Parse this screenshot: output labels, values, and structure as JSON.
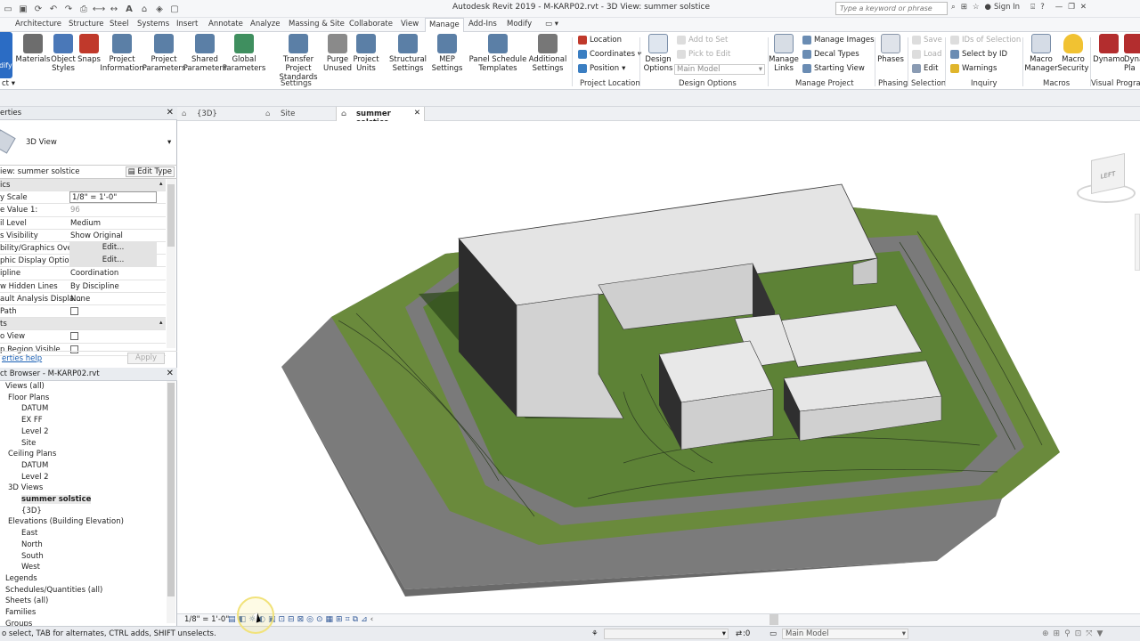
{
  "titlebar": {
    "title": "Autodesk Revit 2019 -  M-KARP02.rvt - 3D View: summer solstice",
    "search_placeholder": "Type a keyword or phrase",
    "sign_in": "Sign In"
  },
  "tabs": [
    "Architecture",
    "Structure",
    "Steel",
    "Systems",
    "Insert",
    "Annotate",
    "Analyze",
    "Massing & Site",
    "Collaborate",
    "View",
    "Manage",
    "Add-Ins",
    "Modify"
  ],
  "active_tab": "Manage",
  "ribbon": {
    "modify": "dify",
    "settings_buttons": [
      {
        "label": "Materials",
        "icon": "materials-icon",
        "color": "#6d6d6d"
      },
      {
        "label": "Object Styles",
        "icon": "object-styles-icon",
        "color": "#4a78b8"
      },
      {
        "label": "Snaps",
        "icon": "snaps-magnet-icon",
        "color": "#c0392b"
      },
      {
        "label": "Project Information",
        "icon": "project-information-icon",
        "color": "#5b7fa6"
      },
      {
        "label": "Project Parameters",
        "icon": "project-parameters-icon",
        "color": "#5b7fa6"
      },
      {
        "label": "Shared Parameters",
        "icon": "shared-parameters-icon",
        "color": "#5b7fa6"
      },
      {
        "label": "Global Parameters",
        "icon": "global-parameters-icon",
        "color": "#3f8f5f"
      },
      {
        "label": "Transfer Project Standards",
        "icon": "transfer-standards-icon",
        "color": "#5b7fa6"
      },
      {
        "label": "Purge Unused",
        "icon": "purge-icon",
        "color": "#8a8a8a"
      },
      {
        "label": "Project Units",
        "icon": "project-units-icon",
        "color": "#5b7fa6"
      },
      {
        "label": "Structural Settings",
        "icon": "structural-settings-icon",
        "color": "#5b7fa6"
      },
      {
        "label": "MEP Settings",
        "icon": "mep-settings-icon",
        "color": "#5b7fa6"
      },
      {
        "label": "Panel Schedule Templates",
        "icon": "panel-schedule-icon",
        "color": "#5b7fa6"
      },
      {
        "label": "Additional Settings",
        "icon": "wrench-icon",
        "color": "#777777"
      }
    ],
    "panel_settings": "Settings",
    "location": [
      "Location",
      "Coordinates",
      "Position"
    ],
    "panel_location": "Project Location",
    "design_options": {
      "btn": "Design Options",
      "add": "Add to Set",
      "pick": "Pick to Edit",
      "main": "Main Model",
      "panel": "Design Options"
    },
    "manage_project": {
      "links": "Manage Links",
      "images": "Manage  Images",
      "decal": "Decal  Types",
      "starting": "Starting  View",
      "panel": "Manage Project"
    },
    "phasing": {
      "btn": "Phases",
      "panel": "Phasing"
    },
    "selection": {
      "save": "Save",
      "load": "Load",
      "edit": "Edit",
      "panel": "Selection"
    },
    "inquiry": {
      "ids": "IDs of  Selection",
      "select": "Select  by ID",
      "warnings": "Warnings",
      "panel": "Inquiry"
    },
    "macros": {
      "manager": "Macro Manager",
      "security": "Macro Security",
      "panel": "Macros"
    },
    "dynamo": {
      "dynamo": "Dynamo",
      "player": "Dyna Pla",
      "panel": "Visual Program"
    }
  },
  "properties": {
    "header": "erties",
    "type": "3D View",
    "view_selector": "iew: summer solstice",
    "edit_type": "Edit Type",
    "rows": [
      {
        "l": "ics",
        "v": "",
        "k": "grp"
      },
      {
        "l": "y Scale",
        "v": "1/8\" = 1'-0\"",
        "k": "box"
      },
      {
        "l": "e Value   1:",
        "v": "96",
        "k": "dim"
      },
      {
        "l": "il Level",
        "v": "Medium",
        "k": ""
      },
      {
        "l": "s Visibility",
        "v": "Show Original",
        "k": ""
      },
      {
        "l": "bility/Graphics Overr...",
        "v": "Edit...",
        "k": "btn"
      },
      {
        "l": "phic Display Options",
        "v": "Edit...",
        "k": "btn"
      },
      {
        "l": "ipline",
        "v": "Coordination",
        "k": ""
      },
      {
        "l": "w Hidden Lines",
        "v": "By Discipline",
        "k": ""
      },
      {
        "l": "ault Analysis Displa...",
        "v": "None",
        "k": ""
      },
      {
        "l": " Path",
        "v": "",
        "k": "chk"
      },
      {
        "l": "ts",
        "v": "",
        "k": "grp"
      },
      {
        "l": "o View",
        "v": "",
        "k": "chk"
      },
      {
        "l": "p Region Visible",
        "v": "",
        "k": "chk"
      }
    ],
    "help": "erties help",
    "apply": "Apply"
  },
  "project_browser": {
    "header": "ct Browser - M-KARP02.rvt",
    "nodes": [
      {
        "t": "Views (all)",
        "d": 0
      },
      {
        "t": "Floor Plans",
        "d": 1
      },
      {
        "t": "DATUM",
        "d": 2
      },
      {
        "t": "EX FF",
        "d": 2
      },
      {
        "t": "Level 2",
        "d": 2
      },
      {
        "t": "Site",
        "d": 2
      },
      {
        "t": "Ceiling Plans",
        "d": 1
      },
      {
        "t": "DATUM",
        "d": 2
      },
      {
        "t": "Level 2",
        "d": 2
      },
      {
        "t": "3D Views",
        "d": 1
      },
      {
        "t": "summer solstice",
        "d": 2,
        "sel": true
      },
      {
        "t": "{3D}",
        "d": 2
      },
      {
        "t": "Elevations (Building Elevation)",
        "d": 1
      },
      {
        "t": "East",
        "d": 2
      },
      {
        "t": "North",
        "d": 2
      },
      {
        "t": "South",
        "d": 2
      },
      {
        "t": "West",
        "d": 2
      },
      {
        "t": "Legends",
        "d": 0
      },
      {
        "t": "Schedules/Quantities (all)",
        "d": 0
      },
      {
        "t": "Sheets (all)",
        "d": 0
      },
      {
        "t": "Families",
        "d": 0
      },
      {
        "t": "Groups",
        "d": 0
      }
    ]
  },
  "doc_tabs": [
    {
      "label": "{3D}"
    },
    {
      "label": "Site"
    },
    {
      "label": "summer solstice",
      "active": true
    }
  ],
  "viewcube_label": "LEFT",
  "view_scale": "1/8\" = 1'-0\"",
  "status": {
    "text": "o select, TAB for alternates, CTRL adds, SHIFT unselects.",
    "zero": ":0",
    "model": "Main Model"
  }
}
